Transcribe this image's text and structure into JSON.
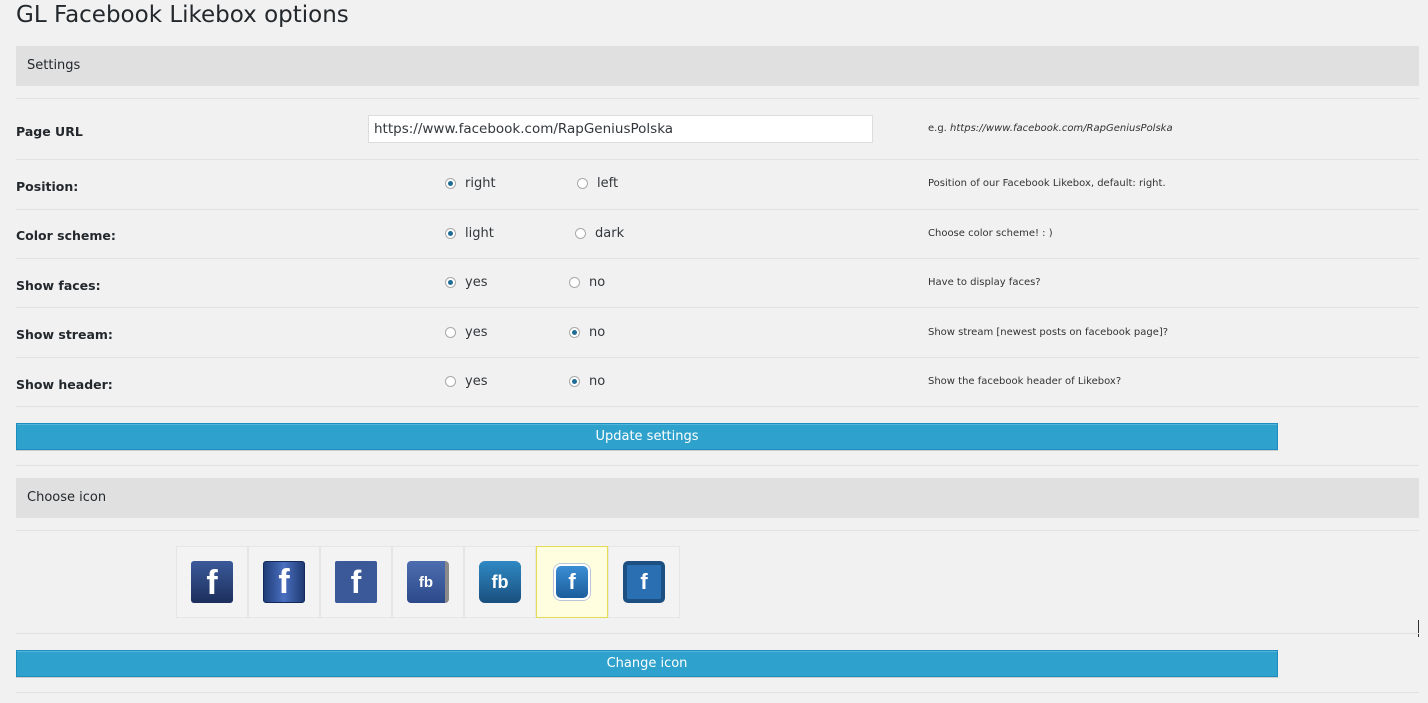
{
  "page_title": "GL Facebook Likebox options",
  "settings_section": {
    "title": "Settings"
  },
  "page_url": {
    "label": "Page URL",
    "value": "https://www.facebook.com/RapGeniusPolska",
    "help_prefix": "e.g. ",
    "help_example": "https://www.facebook.com/RapGeniusPolska"
  },
  "position": {
    "label": "Position:",
    "options": [
      "right",
      "left"
    ],
    "selected": "right",
    "help": "Position of our Facebook Likebox, default: right."
  },
  "color_scheme": {
    "label": "Color scheme:",
    "options": [
      "light",
      "dark"
    ],
    "selected": "light",
    "help": "Choose color scheme! : )"
  },
  "show_faces": {
    "label": "Show faces:",
    "options": [
      "yes",
      "no"
    ],
    "selected": "yes",
    "help": "Have to display faces?"
  },
  "show_stream": {
    "label": "Show stream:",
    "options": [
      "yes",
      "no"
    ],
    "selected": "no",
    "help": "Show stream [newest posts on facebook page]?"
  },
  "show_header": {
    "label": "Show header:",
    "options": [
      "yes",
      "no"
    ],
    "selected": "no",
    "help": "Show the facebook header of Likebox?"
  },
  "update_button": "Update settings",
  "icon_section": {
    "title": "Choose icon"
  },
  "icons": [
    {
      "glyph": "f",
      "name": "facebook-square-dark-icon",
      "selected": false
    },
    {
      "glyph": "f",
      "name": "facebook-glossy-icon",
      "selected": false
    },
    {
      "glyph": "f",
      "name": "facebook-flat-icon",
      "selected": false
    },
    {
      "glyph": "fb",
      "name": "facebook-notebook-icon",
      "selected": false
    },
    {
      "glyph": "fb",
      "name": "facebook-fb-badge-icon",
      "selected": false
    },
    {
      "glyph": "f",
      "name": "facebook-rounded-blue-icon",
      "selected": true
    },
    {
      "glyph": "f",
      "name": "facebook-framed-icon",
      "selected": false
    }
  ],
  "change_icon_button": "Change icon"
}
